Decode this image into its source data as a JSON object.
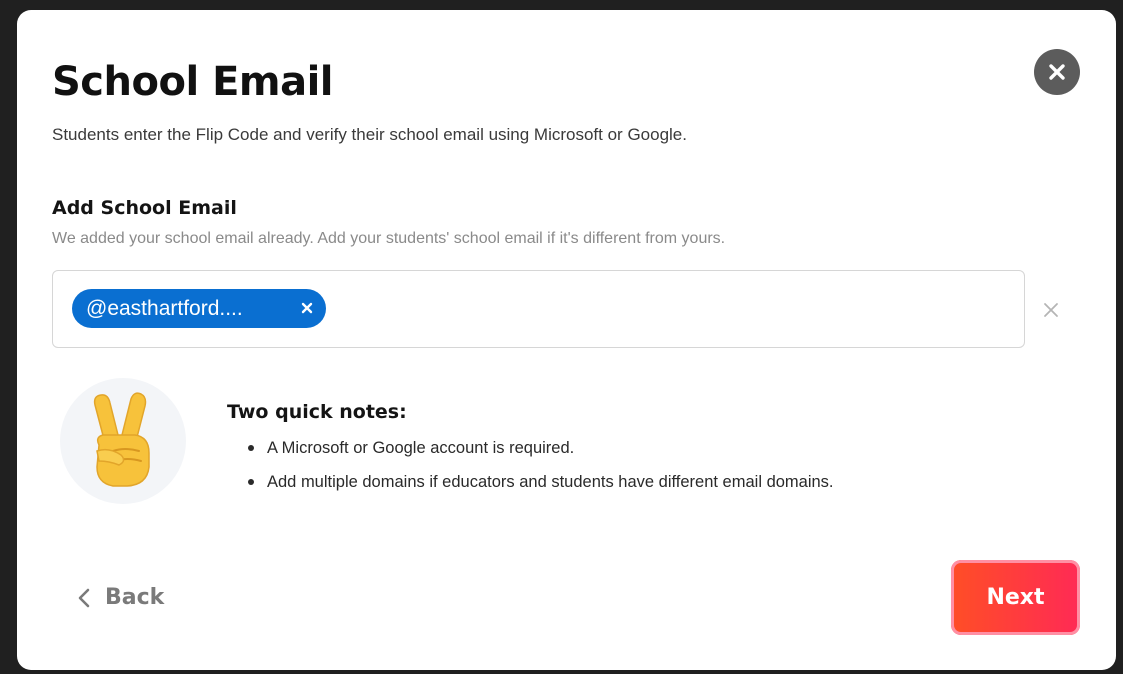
{
  "dialog": {
    "title": "School Email",
    "subtitle": "Students enter the Flip Code and verify their school email using Microsoft or Google.",
    "close_icon": "close-icon"
  },
  "email_section": {
    "heading": "Add School Email",
    "helper": "We added your school email already. Add your students' school email if it's different from yours.",
    "chips": [
      {
        "label": "@easthartford...."
      }
    ],
    "chip_color": "#0a6fd1"
  },
  "notes": {
    "emoji": "victory-hand-emoji",
    "heading": "Two quick notes:",
    "items": [
      "A Microsoft or Google account is required.",
      "Add multiple domains if educators and students have different email domains."
    ]
  },
  "footer": {
    "back_label": "Back",
    "next_label": "Next",
    "accent_color": "#ff3b3f"
  }
}
